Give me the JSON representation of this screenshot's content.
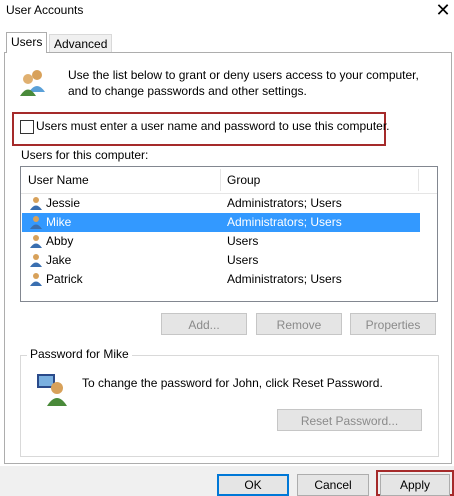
{
  "window": {
    "title": "User Accounts",
    "close_glyph": "✕"
  },
  "tabs": [
    {
      "label": "Users",
      "active": true
    },
    {
      "label": "Advanced",
      "active": false
    }
  ],
  "intro": {
    "icon": "users-group-icon",
    "text": "Use the list below to grant or deny users access to your computer, and to change passwords and other settings."
  },
  "require_login": {
    "label": "Users must enter a user name and password to use this computer.",
    "checked": false
  },
  "users_section": {
    "label": "Users for this computer:",
    "columns": [
      "User Name",
      "Group"
    ],
    "rows": [
      {
        "name": "Jessie",
        "group": "Administrators; Users",
        "selected": false
      },
      {
        "name": "Mike",
        "group": "Administrators; Users",
        "selected": true
      },
      {
        "name": "Abby",
        "group": "Users",
        "selected": false
      },
      {
        "name": "Jake",
        "group": "Users",
        "selected": false
      },
      {
        "name": "Patrick",
        "group": "Administrators; Users",
        "selected": false
      }
    ]
  },
  "user_buttons": {
    "add": "Add...",
    "remove": "Remove",
    "properties": "Properties"
  },
  "password_group": {
    "legend": "Password for Mike",
    "text": "To change the password for John, click Reset Password.",
    "reset_button": "Reset Password..."
  },
  "footer": {
    "ok": "OK",
    "cancel": "Cancel",
    "apply": "Apply"
  },
  "colors": {
    "selection": "#3399ff",
    "highlight_border": "#a52a2a",
    "default_button_border": "#0078d7"
  }
}
